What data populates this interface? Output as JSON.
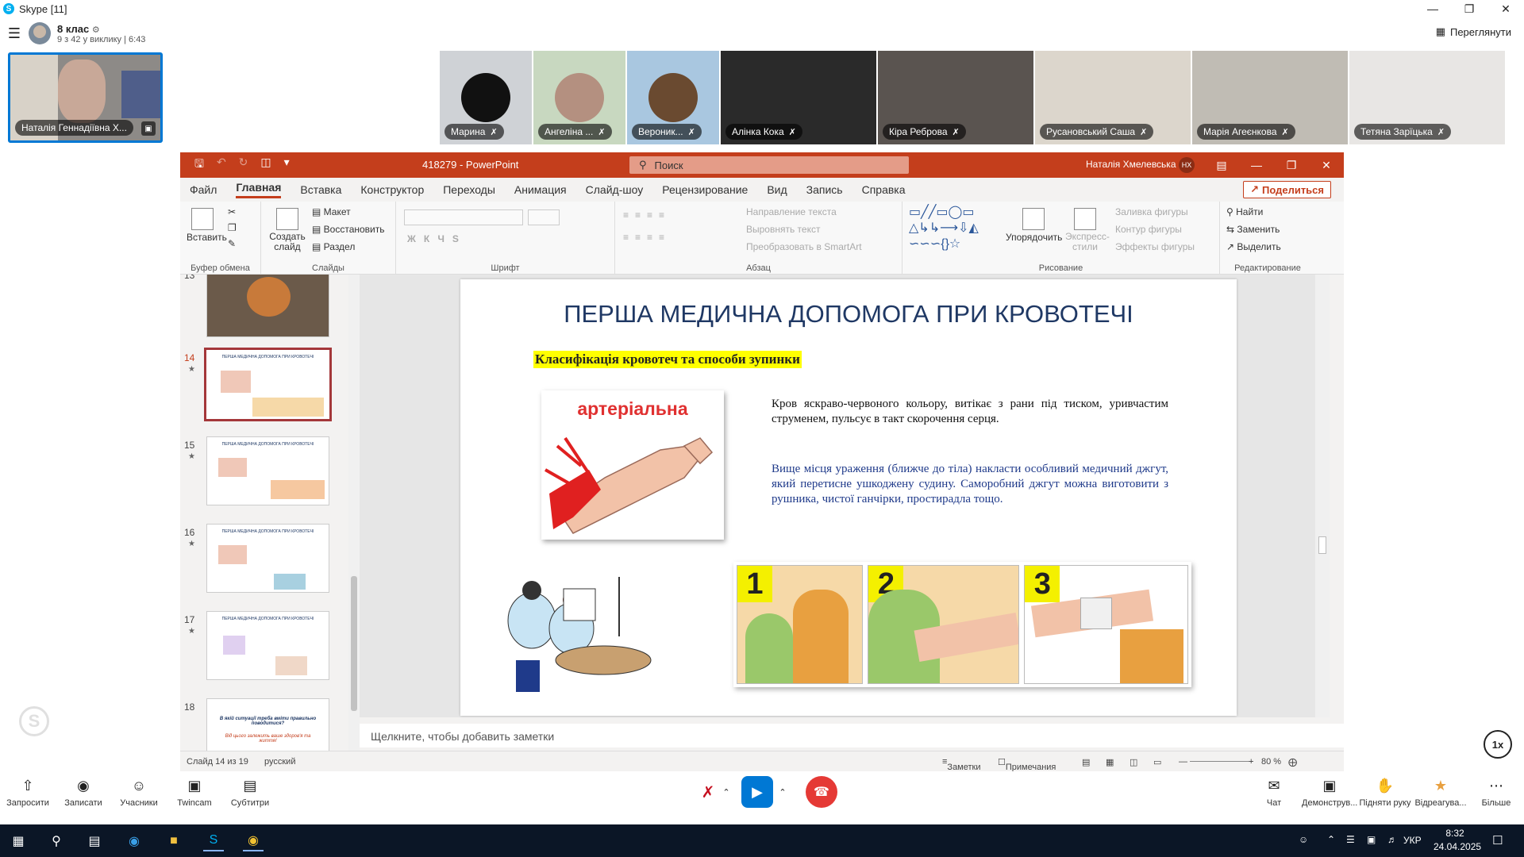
{
  "skype": {
    "window_title": "Skype [11]",
    "logo_letter": "S",
    "group_name": "8 клас",
    "group_sub": "9 з 42 у виклику | 6:43",
    "view_button": "Переглянути",
    "self_name": "Наталія Геннадіївна Х...",
    "participants": [
      {
        "name": "Марина",
        "bg": "#cfd2d6",
        "circle": "#111111"
      },
      {
        "name": "Ангеліна ...",
        "bg": "#c8d8c0",
        "circle": "#b49080"
      },
      {
        "name": "Вероник...",
        "bg": "#a9c7e0",
        "circle": "#6a4a30"
      },
      {
        "name": "Алінка Кока",
        "bg": "#2a2a2a",
        "circle": ""
      },
      {
        "name": "Кіра Реброва",
        "bg": "#5a5450",
        "circle": ""
      },
      {
        "name": "Русановський Саша",
        "bg": "#dcd6cc",
        "circle": ""
      },
      {
        "name": "Марія Агеєнкова",
        "bg": "#c0bcb4",
        "circle": ""
      },
      {
        "name": "Тетяна Зарїцька",
        "bg": "#e8e6e4",
        "circle": ""
      }
    ],
    "bottom_bar": {
      "invite": "Запросити",
      "record": "Записати",
      "participants": "Учасники",
      "twincam": "Twincam",
      "subtitles": "Субтитри",
      "chat": "Чат",
      "demo": "Демонструв...",
      "raise_hand": "Підняти руку",
      "react": "Відреагува...",
      "more": "Більше"
    },
    "speed": "1x"
  },
  "ppt": {
    "doc_title": "418279 - PowerPoint",
    "search_placeholder": "Поиск",
    "user_name": "Наталія Хмелевська",
    "user_initials": "НХ",
    "share_button": "Поделиться",
    "tabs": [
      "Файл",
      "Главная",
      "Вставка",
      "Конструктор",
      "Переходы",
      "Анимация",
      "Слайд-шоу",
      "Рецензирование",
      "Вид",
      "Запись",
      "Справка"
    ],
    "active_tab": "Главная",
    "ribbon": {
      "paste": "Вставить",
      "clipboard_group": "Буфер обмена",
      "create_slide": "Создать слайд",
      "layout": "Макет",
      "reset": "Восстановить",
      "section": "Раздел",
      "slides_group": "Слайды",
      "font_group": "Шрифт",
      "text_dir": "Направление текста",
      "align_text": "Выровнять текст",
      "smartart": "Преобразовать в SmartArt",
      "paragraph_group": "Абзац",
      "arrange": "Упорядочить",
      "quick_styles": "Экспресс-стили",
      "fill": "Заливка фигуры",
      "outline": "Контур фигуры",
      "effects": "Эффекты фигуры",
      "drawing_group": "Рисование",
      "find": "Найти",
      "replace": "Заменить",
      "select": "Выделить",
      "editing_group": "Редактирование"
    },
    "thumbs": [
      {
        "num": "13"
      },
      {
        "num": "14"
      },
      {
        "num": "15"
      },
      {
        "num": "16"
      },
      {
        "num": "17"
      },
      {
        "num": "18",
        "text1": "В якій ситуації треба вміти правильно поводитися?",
        "text2": "Від цього залежить ваше здоров'я та життя!"
      }
    ],
    "thumb_title": "ПЕРША МЕДИЧНА ДОПОМОГА ПРИ КРОВОТЕЧІ",
    "slide": {
      "title": "ПЕРША МЕДИЧНА ДОПОМОГА ПРИ КРОВОТЕЧІ",
      "subtitle": "Класифікація  кровотеч та способи зупинки",
      "card_label": "артеріальна",
      "para1": "Кров яскраво-червоного кольору, витікає з рани під тиском, уривчастим струменем, пульсує в такт скорочення серця.",
      "para2": "Вище місця ураження (ближче до тіла) накласти особливий медичний джгут, який перетисне ушкоджену судину. Саморобний джгут можна виготовити з рушника, чистої ганчірки, простирадла тощо.",
      "steps": [
        "1",
        "2",
        "3"
      ]
    },
    "notes_placeholder": "Щелкните, чтобы добавить заметки",
    "status": {
      "slide_info": "Слайд 14 из 19",
      "language": "русский",
      "notes": "Заметки",
      "comments": "Примечания",
      "zoom": "80 %"
    }
  },
  "taskbar": {
    "lang": "УКР",
    "time": "8:32",
    "date": "24.04.2025"
  }
}
